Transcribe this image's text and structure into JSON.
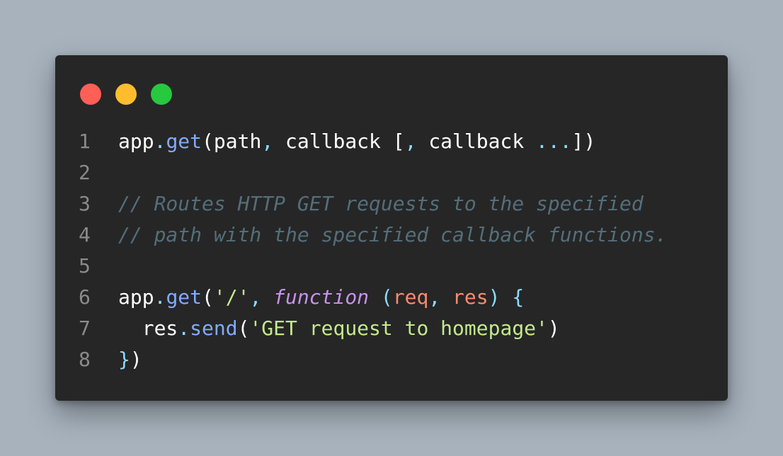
{
  "window": {
    "controls": [
      "close",
      "minimize",
      "maximize"
    ]
  },
  "code": {
    "lines": [
      {
        "number": "1",
        "tokens": [
          {
            "text": "app",
            "type": "plain"
          },
          {
            "text": ".",
            "type": "punct"
          },
          {
            "text": "get",
            "type": "method"
          },
          {
            "text": "(path",
            "type": "plain"
          },
          {
            "text": ",",
            "type": "punct"
          },
          {
            "text": " callback ",
            "type": "plain"
          },
          {
            "text": "[",
            "type": "plain"
          },
          {
            "text": ",",
            "type": "punct"
          },
          {
            "text": " callback ",
            "type": "plain"
          },
          {
            "text": "...",
            "type": "punct"
          },
          {
            "text": "])",
            "type": "plain"
          }
        ]
      },
      {
        "number": "2",
        "tokens": []
      },
      {
        "number": "3",
        "tokens": [
          {
            "text": "// Routes HTTP GET requests to the specified",
            "type": "comment"
          }
        ]
      },
      {
        "number": "4",
        "tokens": [
          {
            "text": "// path with the specified callback functions.",
            "type": "comment"
          }
        ]
      },
      {
        "number": "5",
        "tokens": []
      },
      {
        "number": "6",
        "tokens": [
          {
            "text": "app",
            "type": "plain"
          },
          {
            "text": ".",
            "type": "punct"
          },
          {
            "text": "get",
            "type": "method"
          },
          {
            "text": "(",
            "type": "plain"
          },
          {
            "text": "'/'",
            "type": "string"
          },
          {
            "text": ",",
            "type": "punct"
          },
          {
            "text": " ",
            "type": "plain"
          },
          {
            "text": "function",
            "type": "keyword"
          },
          {
            "text": " ",
            "type": "plain"
          },
          {
            "text": "(",
            "type": "punct"
          },
          {
            "text": "req",
            "type": "param"
          },
          {
            "text": ",",
            "type": "punct"
          },
          {
            "text": " ",
            "type": "plain"
          },
          {
            "text": "res",
            "type": "param"
          },
          {
            "text": ")",
            "type": "punct"
          },
          {
            "text": " ",
            "type": "plain"
          },
          {
            "text": "{",
            "type": "punct"
          }
        ]
      },
      {
        "number": "7",
        "tokens": [
          {
            "text": "  res",
            "type": "plain"
          },
          {
            "text": ".",
            "type": "punct"
          },
          {
            "text": "send",
            "type": "method"
          },
          {
            "text": "(",
            "type": "plain"
          },
          {
            "text": "'GET request to homepage'",
            "type": "string"
          },
          {
            "text": ")",
            "type": "plain"
          }
        ]
      },
      {
        "number": "8",
        "tokens": [
          {
            "text": "}",
            "type": "punct"
          },
          {
            "text": ")",
            "type": "plain"
          }
        ]
      }
    ]
  },
  "colors": {
    "background": "#a7b2bd",
    "window": "#262626",
    "close": "#ff5f56",
    "minimize": "#ffbd2e",
    "maximize": "#27c93f"
  }
}
